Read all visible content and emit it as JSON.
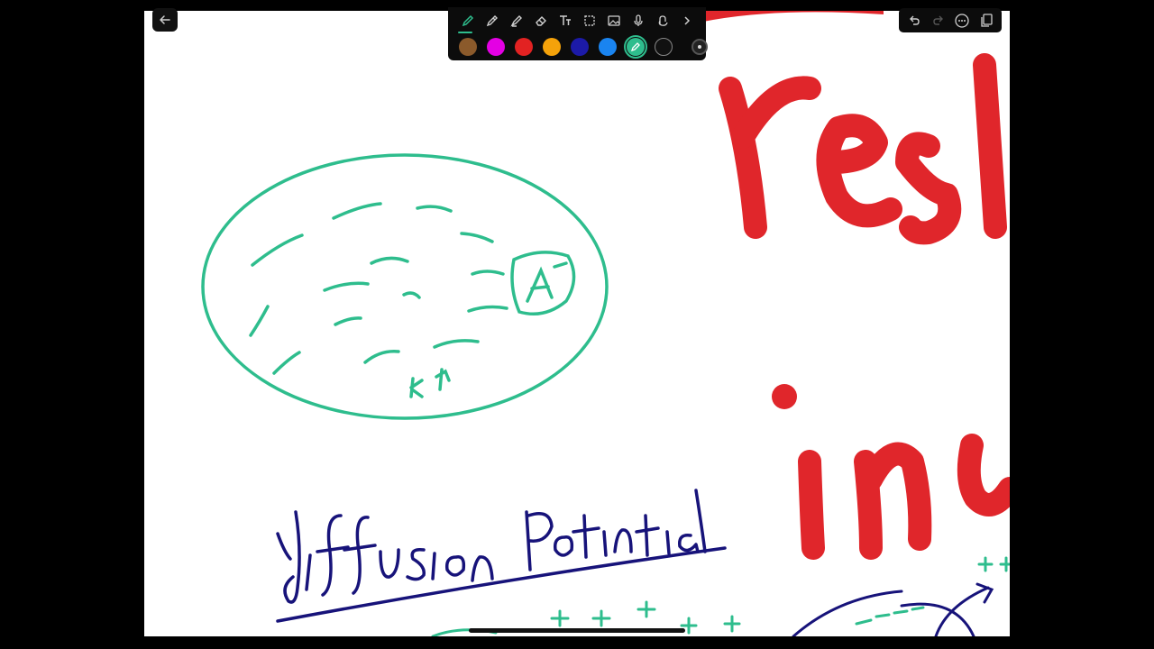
{
  "toolbar": {
    "tools": [
      {
        "name": "pen",
        "active": true
      },
      {
        "name": "pencil",
        "active": false
      },
      {
        "name": "highlighter",
        "active": false
      },
      {
        "name": "eraser",
        "active": false
      },
      {
        "name": "text",
        "active": false
      },
      {
        "name": "shape",
        "active": false
      },
      {
        "name": "image",
        "active": false
      },
      {
        "name": "microphone",
        "active": false
      },
      {
        "name": "lasso",
        "active": false
      },
      {
        "name": "more",
        "active": false
      }
    ],
    "colors": [
      "#8b5a2b",
      "#e400e4",
      "#e22222",
      "#f5a20a",
      "#1c1aa8",
      "#1a84f0",
      "#2ebd8d",
      "#111111"
    ],
    "selected_color": "#2ebd8d"
  },
  "ink_colors": {
    "teal": "#2ebd8d",
    "navy": "#17137a",
    "red": "#e0262b"
  }
}
